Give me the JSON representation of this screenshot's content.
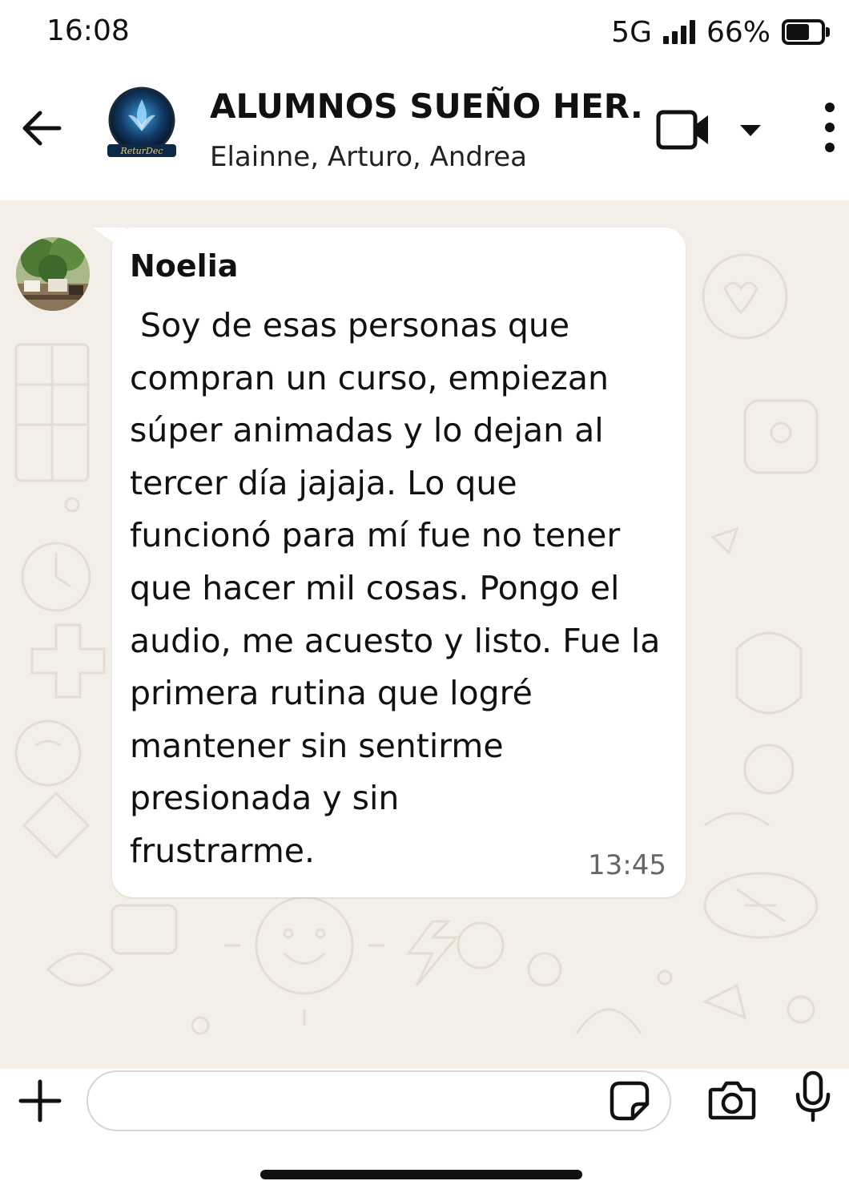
{
  "status_bar": {
    "time": "16:08",
    "network": "5G",
    "battery_percent": "66%",
    "battery_level": 0.66,
    "icons": [
      "signal-icon",
      "battery-icon"
    ]
  },
  "header": {
    "title": "ALUMNOS SUEÑO HER...",
    "members": "Elainne, Arturo, Andrea",
    "icons": [
      "back-arrow-icon",
      "group-avatar",
      "video-camera-icon",
      "chevron-down-icon",
      "more-vertical-icon"
    ]
  },
  "message": {
    "sender": "Noelia",
    "text": " Soy de esas personas que\ncompran un curso, empiezan\nsúper animadas y lo dejan al\ntercer día jajaja. Lo que\nfuncionó para mí fue no tener\nque hacer mil cosas. Pongo el\naudio, me acuesto y listo. Fue la\nprimera rutina que logré\nmantener sin sentirme\npresionada y sin\nfrustrarme.",
    "time": "13:45"
  },
  "input_bar": {
    "icons": [
      "plus-icon",
      "sticker-icon",
      "camera-icon",
      "microphone-icon"
    ]
  },
  "colors": {
    "wallpaper": "#f3efe8",
    "bubble": "#ffffff",
    "text": "#111111",
    "timestamp": "#666666"
  }
}
